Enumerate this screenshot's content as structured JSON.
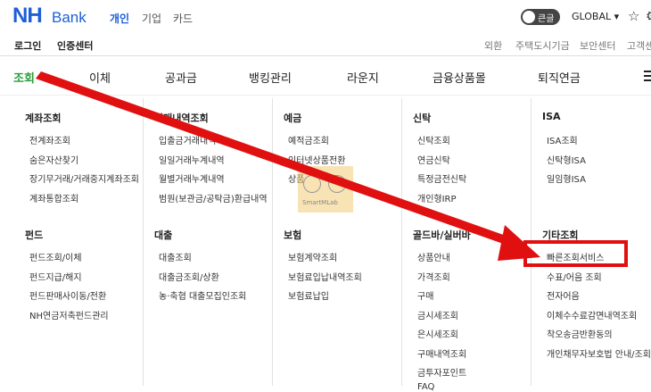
{
  "header": {
    "logo_nh": "NH",
    "logo_bank": "Bank",
    "modes": [
      "개인",
      "기업",
      "카드"
    ],
    "toggle_label": "큰글",
    "global_label": "GLOBAL ▾",
    "icons": [
      "star-icon",
      "gear-icon"
    ]
  },
  "subnav": {
    "left": [
      "로그인",
      "인증센터"
    ],
    "right": [
      "외환",
      "주택도시기금",
      "보안센터",
      "고객센"
    ]
  },
  "gnb": [
    "조회",
    "이체",
    "공과금",
    "뱅킹관리",
    "라운지",
    "금융상품몰",
    "퇴직연금"
  ],
  "menu": {
    "col1": {
      "group1": {
        "title": "계좌조회",
        "items": [
          "전계좌조회",
          "숨은자산찾기",
          "장기무거래/거래중지계좌조회",
          "계좌통합조회"
        ]
      },
      "group2": {
        "title": "펀드",
        "items": [
          "펀드조회/이체",
          "펀드지급/해지",
          "펀드판매사이동/전환",
          "NH연금저축펀드관리"
        ]
      }
    },
    "col2": {
      "group1": {
        "title": "거래내역조회",
        "items": [
          "입출금거래내역",
          "일일거래누계내역",
          "월별거래누계내역",
          "범원(보관금/공탁금)환급내역"
        ]
      },
      "group2": {
        "title": "대출",
        "items": [
          "대출조회",
          "대출금조회/상환",
          "농·축협 대출모집인조회"
        ]
      }
    },
    "col3": {
      "group1": {
        "title": "예금",
        "items": [
          "예적금조회",
          "인터넷상품전환",
          "상품"
        ]
      },
      "group2": {
        "title": "보험",
        "items": [
          "보험계약조회",
          "보험료입납내역조회",
          "보험료납입"
        ]
      }
    },
    "col4": {
      "group1": {
        "title": "신탁",
        "items": [
          "신탁조회",
          "연금신탁",
          "특정금전신탁",
          "개인형IRP"
        ]
      },
      "group2": {
        "title": "골드바/실버바",
        "items": [
          "상품안내",
          "가격조회",
          "구매",
          "금시세조회",
          "은시세조회",
          "구매내역조회",
          "금투자포인트",
          "FAQ"
        ]
      }
    },
    "col5": {
      "group1": {
        "title": "ISA",
        "items": [
          "ISA조회",
          "신탁형ISA",
          "일임형ISA"
        ]
      },
      "group2": {
        "title": "기타조회",
        "items": [
          "빠른조회서비스",
          "수표/어음 조회",
          "전자어음",
          "이체수수료감면내역조회",
          "착오송금반환동의",
          "개인채무자보호법 안내/조회"
        ]
      }
    }
  },
  "watermark": "SmartMLab",
  "annotation_color": "#e01010"
}
